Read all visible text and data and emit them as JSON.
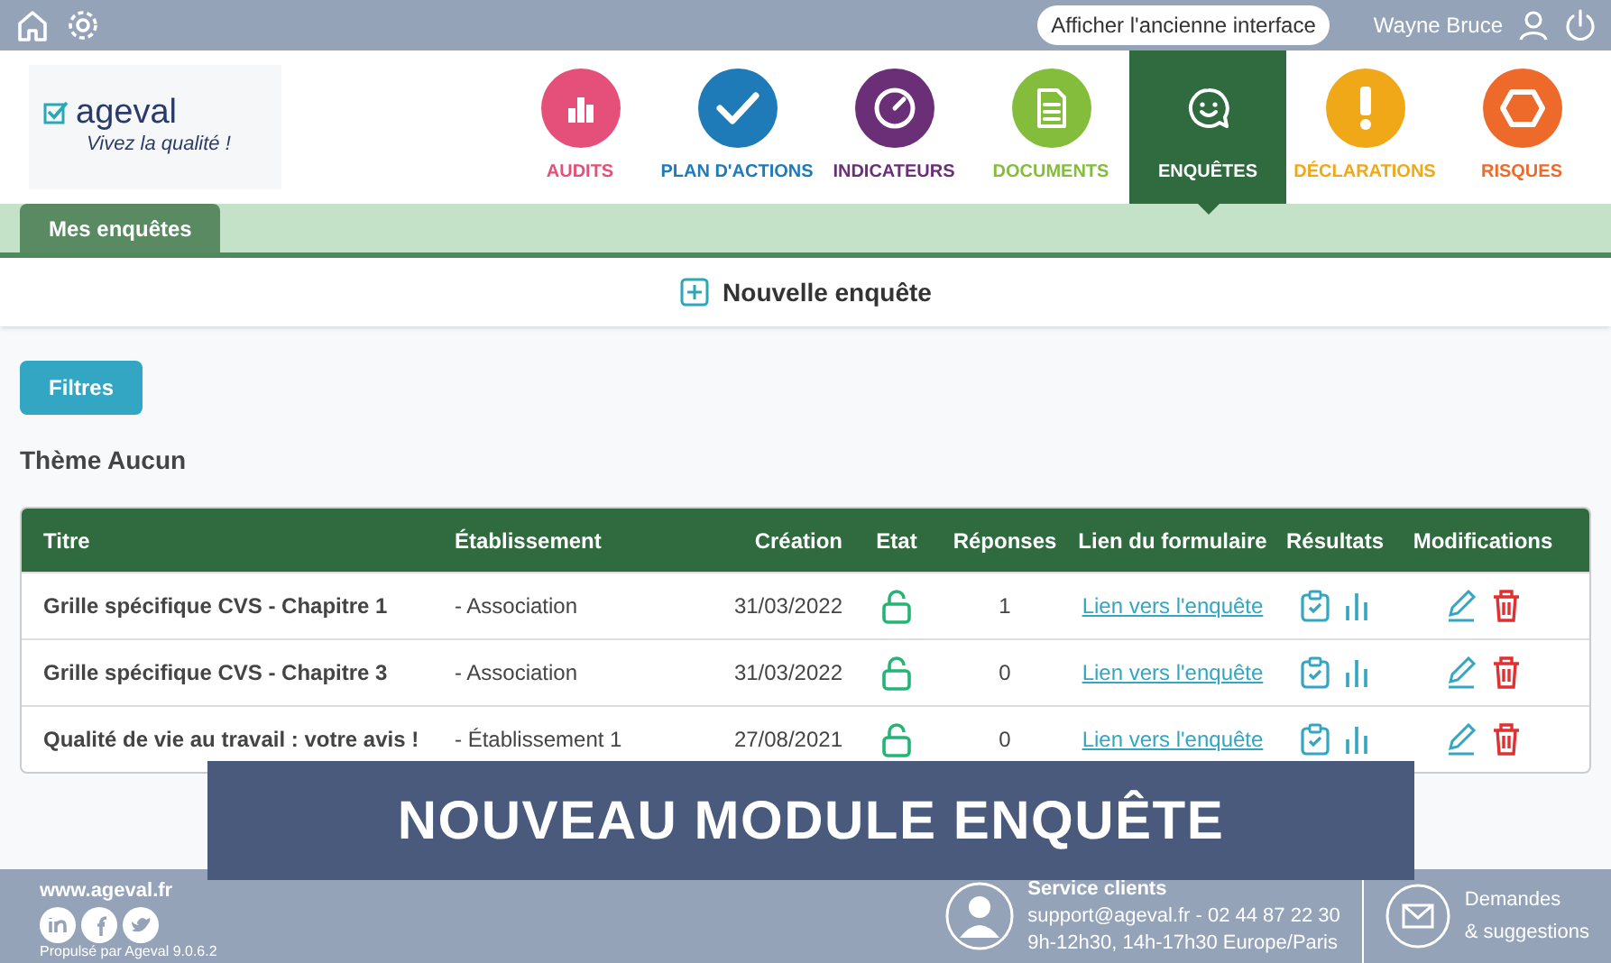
{
  "top_bar": {
    "old_interface_button": "Afficher l'ancienne interface",
    "user_name": "Wayne Bruce"
  },
  "logo": {
    "name": "ageval",
    "tagline": "Vivez la qualité !"
  },
  "nav": [
    {
      "label": "AUDITS",
      "kind": "bars",
      "color": "#e4507a",
      "selected": false
    },
    {
      "label": "PLAN D'ACTIONS",
      "kind": "check",
      "color": "#1f7ab8",
      "selected": false
    },
    {
      "label": "INDICATEURS",
      "kind": "gauge",
      "color": "#6b2f78",
      "selected": false
    },
    {
      "label": "DOCUMENTS",
      "kind": "document",
      "color": "#84bd3c",
      "selected": false
    },
    {
      "label": "ENQUÊTES",
      "kind": "smiley",
      "color": "#2f6b3f",
      "selected": true
    },
    {
      "label": "DÉCLARATIONS",
      "kind": "exclamation",
      "color": "#f0a818",
      "selected": false
    },
    {
      "label": "RISQUES",
      "kind": "hexagon",
      "color": "#ee6a2a",
      "selected": false
    }
  ],
  "tabs": [
    {
      "label": "Mes enquêtes",
      "selected": true
    }
  ],
  "new_survey_button": "Nouvelle enquête",
  "filters_button": "Filtres",
  "theme_heading": "Thème Aucun",
  "table": {
    "columns": [
      "Titre",
      "Établissement",
      "Création",
      "Etat",
      "Réponses",
      "Lien du formulaire",
      "Résultats",
      "Modifications"
    ],
    "rows": [
      {
        "title": "Grille spécifique CVS - Chapitre 1",
        "establishment": "- Association",
        "created": "31/03/2022",
        "locked": false,
        "responses": "1",
        "link": "Lien vers l'enquête"
      },
      {
        "title": "Grille spécifique CVS - Chapitre 3",
        "establishment": "- Association",
        "created": "31/03/2022",
        "locked": false,
        "responses": "0",
        "link": "Lien vers l'enquête"
      },
      {
        "title": "Qualité de vie au travail : votre avis !",
        "establishment": "- Établissement 1",
        "created": "27/08/2021",
        "locked": false,
        "responses": "0",
        "link": "Lien vers l'enquête"
      }
    ]
  },
  "banner": "NOUVEAU MODULE ENQUÊTE",
  "footer": {
    "website": "www.ageval.fr",
    "powered_by": "Propulsé par Ageval 9.0.6.2",
    "service_title": "Service clients",
    "service_contact": "support@ageval.fr - 02 44 87 22 30",
    "service_hours": "9h-12h30, 14h-17h30 Europe/Paris",
    "requests": "Demandes",
    "requests_line2": "& suggestions"
  }
}
